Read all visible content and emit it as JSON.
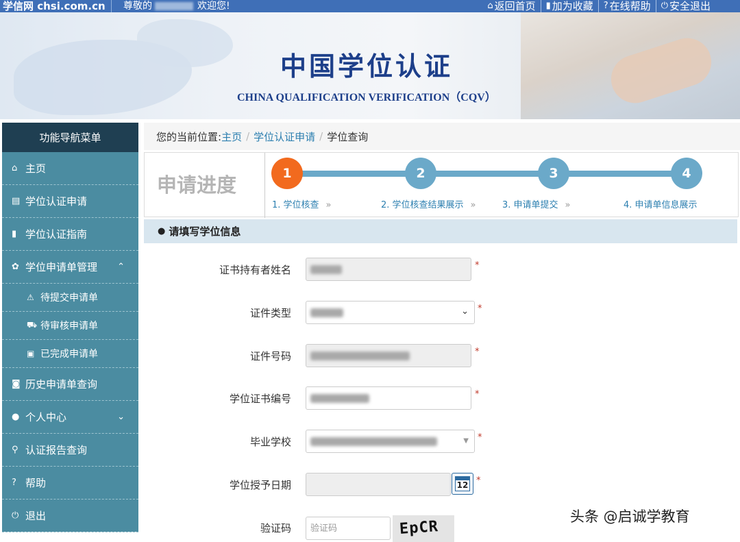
{
  "topbar": {
    "logo": "学信网 chsi.com.cn",
    "greet_prefix": "尊敬的",
    "greet_suffix": "欢迎您!",
    "links": [
      {
        "icon": "home-icon",
        "glyph": "⌂",
        "label": "返回首页"
      },
      {
        "icon": "bookmark-icon",
        "glyph": "▮",
        "label": "加为收藏"
      },
      {
        "icon": "help-icon",
        "glyph": "?",
        "label": "在线帮助"
      },
      {
        "icon": "power-icon",
        "glyph": "⏻",
        "label": "安全退出"
      }
    ]
  },
  "banner": {
    "title_cn": "中国学位认证",
    "title_en": "CHINA QUALIFICATION VERIFICATION（CQV）"
  },
  "sidebar": {
    "header": "功能导航菜单",
    "items": [
      {
        "label": "主页",
        "glyph": "⌂"
      },
      {
        "label": "学位认证申请",
        "glyph": "▤"
      },
      {
        "label": "学位认证指南",
        "glyph": "▮"
      },
      {
        "label": "学位申请单管理",
        "glyph": "✿",
        "chevron": "⌃"
      },
      {
        "label": "待提交申请单",
        "glyph": "⚠"
      },
      {
        "label": "待审核申请单",
        "glyph": "⛟"
      },
      {
        "label": "已完成申请单",
        "glyph": "▣"
      },
      {
        "label": "历史申请单查询",
        "glyph": "◙"
      },
      {
        "label": "个人中心",
        "glyph": "●",
        "chevron": "⌄"
      },
      {
        "label": "认证报告查询",
        "glyph": "⚲"
      },
      {
        "label": "帮助",
        "glyph": "?"
      },
      {
        "label": "退出",
        "glyph": "⏻"
      }
    ]
  },
  "breadcrumb": {
    "prefix": "您的当前位置:",
    "home": "主页",
    "apply": "学位认证申请",
    "current": "学位查询"
  },
  "progress": {
    "title": "申请进度",
    "steps": [
      {
        "num": "1",
        "label": "1. 学位核查"
      },
      {
        "num": "2",
        "label": "2. 学位核查结果展示"
      },
      {
        "num": "3",
        "label": "3. 申请单提交"
      },
      {
        "num": "4",
        "label": "4. 申请单信息展示"
      }
    ],
    "active_step": 1,
    "arrow": "»"
  },
  "form": {
    "section_title": "请填写学位信息",
    "fields": [
      {
        "label": "证书持有者姓名"
      },
      {
        "label": "证件类型"
      },
      {
        "label": "证件号码"
      },
      {
        "label": "学位证书编号"
      },
      {
        "label": "毕业学校"
      },
      {
        "label": "学位授予日期"
      },
      {
        "label": "验证码"
      }
    ],
    "required_mark": "*",
    "calendar_day": "12",
    "captcha_placeholder": "验证码",
    "captcha_text": "EpCR"
  },
  "watermark": "头条 @启诚学教育"
}
